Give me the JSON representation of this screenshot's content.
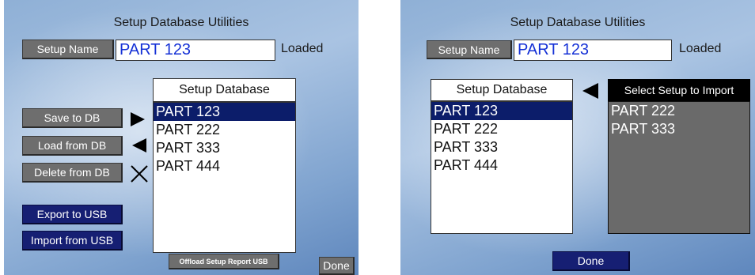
{
  "left_panel": {
    "title": "Setup Database Utilities",
    "setup_name_button": "Setup Name",
    "setup_name_value": "PART 123",
    "status": "Loaded",
    "db_header": "Setup Database",
    "db_items": [
      "PART 123",
      "PART 222",
      "PART 333",
      "PART 444"
    ],
    "selected_index": 0,
    "save_button": "Save to DB",
    "load_button": "Load from DB",
    "delete_button": "Delete from DB",
    "export_button": "Export to USB",
    "import_button": "Import from USB",
    "offload_button": "Offload Setup Report USB",
    "done_button": "Done"
  },
  "right_panel": {
    "title": "Setup Database Utilities",
    "setup_name_button": "Setup Name",
    "setup_name_value": "PART 123",
    "status": "Loaded",
    "db_header": "Setup Database",
    "db_items": [
      "PART 123",
      "PART 222",
      "PART 333",
      "PART 444"
    ],
    "selected_index": 0,
    "import_header": "Select Setup to Import",
    "import_items": [
      "PART 222",
      "PART 333"
    ],
    "done_button": "Done"
  },
  "icons": {
    "save_arrow": "arrow-right-icon",
    "load_arrow": "arrow-left-icon",
    "delete_mark": "x-mark-icon",
    "import_arrow": "arrow-left-icon"
  },
  "colors": {
    "button_gray": "#6e6e6e",
    "button_navy": "#161f73",
    "selection": "#0c1d6a",
    "name_text": "#1531d6",
    "import_list_bg": "#6a6a6a"
  }
}
